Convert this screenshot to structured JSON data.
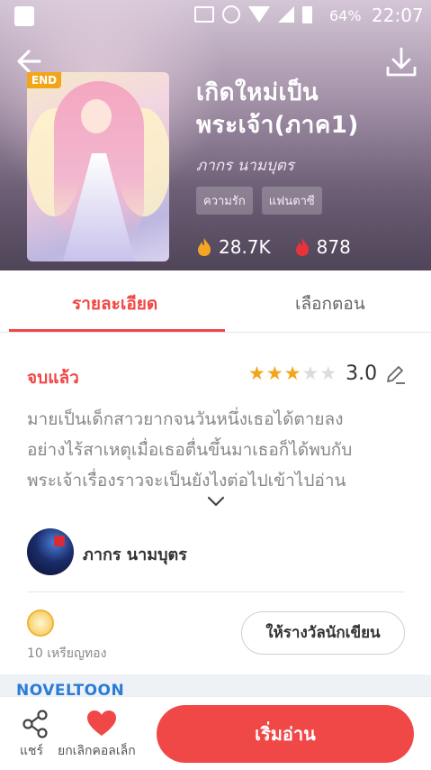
{
  "status_bar": {
    "battery": "64%",
    "time": "22:07"
  },
  "book": {
    "title_line1": "เกิดใหม่เป็น",
    "title_line2": "พระเจ้า(ภาค1)",
    "author": "ภากร นามบุตร",
    "end_badge": "END",
    "tags": [
      "ความรัก",
      "แฟนตาซี"
    ],
    "views": "28.7K",
    "likes": "878"
  },
  "tabs": {
    "detail": "รายละเอียด",
    "chapters": "เลือกตอน",
    "active": "detail"
  },
  "detail": {
    "status": "จบแล้ว",
    "rating": "3.0",
    "stars_filled": 3,
    "stars_total": 5,
    "synopsis_line1": "มายเป็นเด็กสาวยากจนวันหนึ่งเธอได้ตายลง",
    "synopsis_line2": "อย่างไร้สาเหตุเมื่อเธอตื่นขึ้นมาเธอก็ได้พบกับ",
    "synopsis_line3": "พระเจ้าเรื่องราวจะเป็นยังไงต่อไปเข้าไปอ่าน"
  },
  "author_row": {
    "name": "ภากร นามบุตร"
  },
  "reward": {
    "gold_text": "10 เหรียญทอง",
    "button_label": "ให้รางวัลนักเขียน"
  },
  "brand": "NOVELTOON",
  "bottom_bar": {
    "share_label": "แชร์",
    "collect_label": "ยกเลิกคอลเล็ก",
    "read_label": "เริ่มอ่าน"
  },
  "colors": {
    "accent": "#f04847",
    "star": "#f3a51a",
    "brand": "#2a7cd6"
  }
}
